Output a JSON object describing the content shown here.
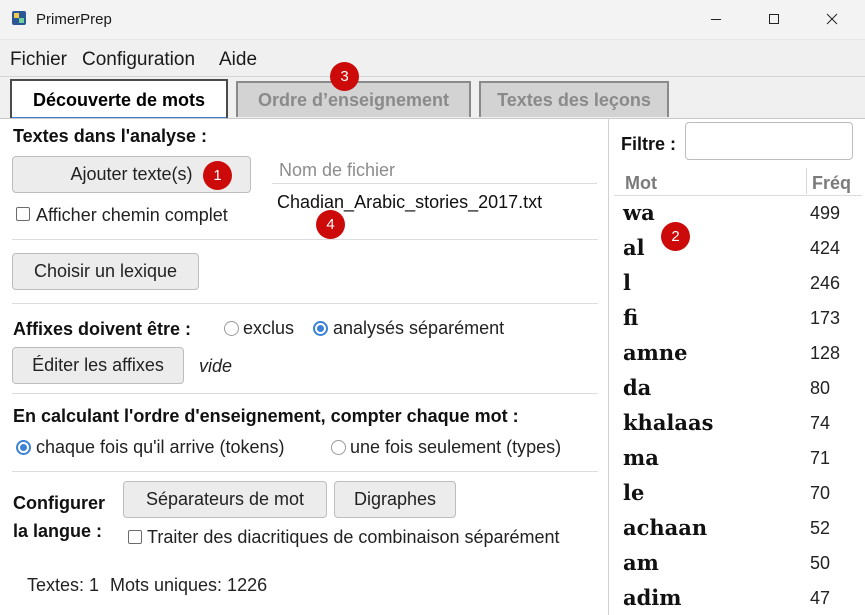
{
  "window": {
    "title": "PrimerPrep"
  },
  "menu": {
    "items": [
      "Fichier",
      "Configuration",
      "Aide"
    ]
  },
  "tabs": [
    {
      "label": "Découverte de mots"
    },
    {
      "label": "Ordre d’enseignement"
    },
    {
      "label": "Textes des leçons"
    }
  ],
  "texts_section": {
    "heading": "Textes dans l'analyse :",
    "add_button": "Ajouter texte(s)",
    "show_path_label": "Afficher chemin complet",
    "filename_header": "Nom de fichier",
    "files": [
      "Chadian_Arabic_stories_2017.txt"
    ]
  },
  "lexicon": {
    "button": "Choisir un lexique"
  },
  "affixes": {
    "label": "Affixes doivent être :",
    "option_excluded": "exclus",
    "option_separate": "analysés séparément",
    "selected": "analysés séparément",
    "edit_button": "Éditer les affixes",
    "status": "vide"
  },
  "counting": {
    "label": "En calculant l'ordre d'enseignement, compter chaque mot :",
    "option_tokens": "chaque fois qu'il arrive (tokens)",
    "option_types": "une fois seulement (types)",
    "selected": "chaque fois qu'il arrive (tokens)"
  },
  "language": {
    "label_line1": "Configurer",
    "label_line2": "la langue :",
    "separators_button": "Séparateurs de mot",
    "digraphs_button": "Digraphes",
    "diacritics_label": "Traiter des diacritiques de combinaison séparément"
  },
  "status": {
    "texts": "Textes: 1",
    "unique_words": "Mots uniques: 1226"
  },
  "word_list": {
    "filter_label": "Filtre :",
    "filter_value": "",
    "col_word": "Mot",
    "col_freq": "Fréq",
    "rows": [
      {
        "word": "wa",
        "freq": "499"
      },
      {
        "word": "al",
        "freq": "424"
      },
      {
        "word": "l",
        "freq": "246"
      },
      {
        "word": "fi",
        "freq": "173"
      },
      {
        "word": "amne",
        "freq": "128"
      },
      {
        "word": "da",
        "freq": "80"
      },
      {
        "word": "khalaas",
        "freq": "74"
      },
      {
        "word": "ma",
        "freq": "71"
      },
      {
        "word": "le",
        "freq": "70"
      },
      {
        "word": "achaan",
        "freq": "52"
      },
      {
        "word": "am",
        "freq": "50"
      },
      {
        "word": "adim",
        "freq": "47"
      }
    ]
  },
  "badges": [
    "1",
    "2",
    "3",
    "4"
  ],
  "colors": {
    "accent": "#3b82d6",
    "badge": "#cc0a0a",
    "tab_inactive": "#d3d3d3"
  }
}
